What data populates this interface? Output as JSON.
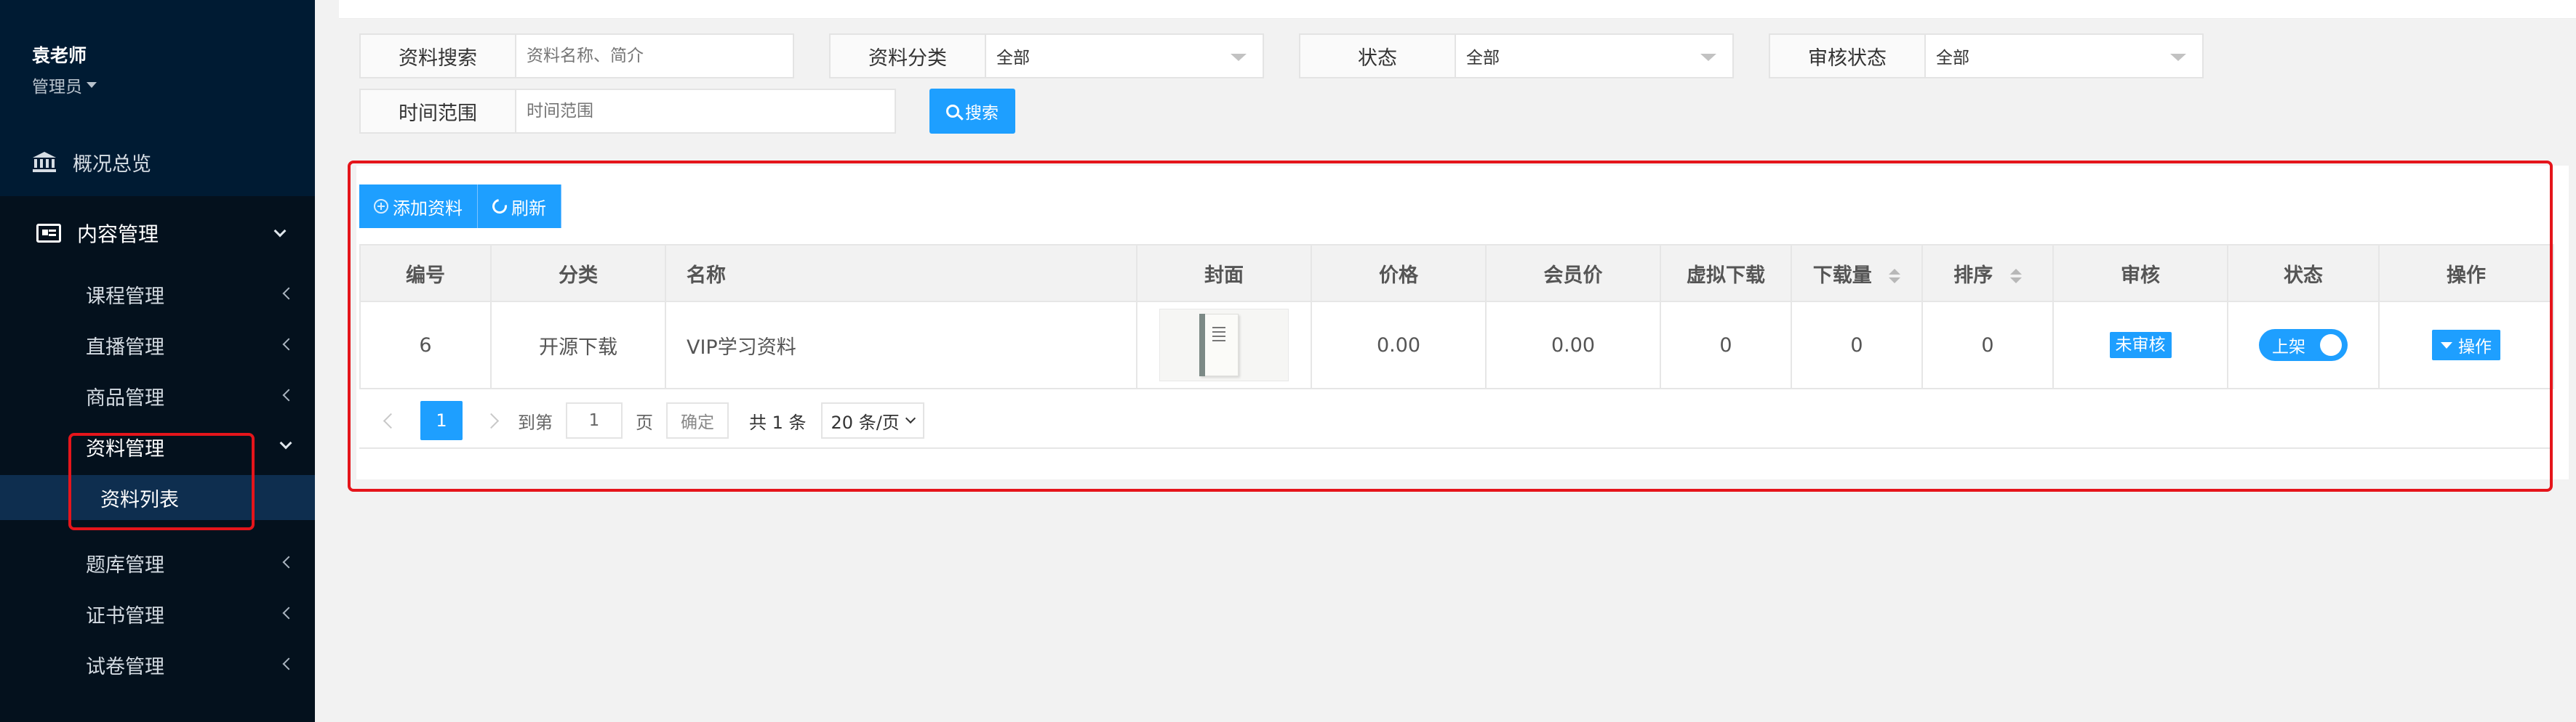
{
  "sidebar": {
    "user": {
      "name": "袁老师",
      "role": "管理员"
    },
    "overview": {
      "label": "概况总览",
      "icon": "bank-icon"
    },
    "content_group": {
      "label": "内容管理",
      "icon": "newspaper-icon"
    },
    "items": [
      {
        "label": "课程管理"
      },
      {
        "label": "直播管理"
      },
      {
        "label": "商品管理"
      },
      {
        "label": "资料管理"
      },
      {
        "label": "资料列表"
      },
      {
        "label": "题库管理"
      },
      {
        "label": "证书管理"
      },
      {
        "label": "试卷管理"
      }
    ]
  },
  "filters": {
    "search": {
      "label": "资料搜索",
      "placeholder": "资料名称、简介"
    },
    "category": {
      "label": "资料分类",
      "value": "全部"
    },
    "status": {
      "label": "状态",
      "value": "全部"
    },
    "review": {
      "label": "审核状态",
      "value": "全部"
    },
    "time": {
      "label": "时间范围",
      "placeholder": "时间范围"
    },
    "search_button": "搜索"
  },
  "toolbar": {
    "add_label": "添加资料",
    "refresh_label": "刷新"
  },
  "table": {
    "headers": [
      "编号",
      "分类",
      "名称",
      "封面",
      "价格",
      "会员价",
      "虚拟下载",
      "下载量",
      "排序",
      "审核",
      "状态",
      "操作"
    ],
    "rows": [
      {
        "id": "6",
        "category": "开源下载",
        "name": "VIP学习资料",
        "price": "0.00",
        "member_price": "0.00",
        "virtual_downloads": "0",
        "downloads": "0",
        "sort": "0",
        "review": "未审核",
        "status": "上架",
        "action": "操作"
      }
    ]
  },
  "pagination": {
    "current_page": "1",
    "goto_label": "到第",
    "goto_value": "1",
    "page_unit": "页",
    "confirm_label": "确定",
    "total_label": "共 1 条",
    "page_size": "20 条/页"
  },
  "colors": {
    "accent": "#1e9fff",
    "sidebar_bg": "#001b33",
    "highlight_border": "#e5151b"
  }
}
